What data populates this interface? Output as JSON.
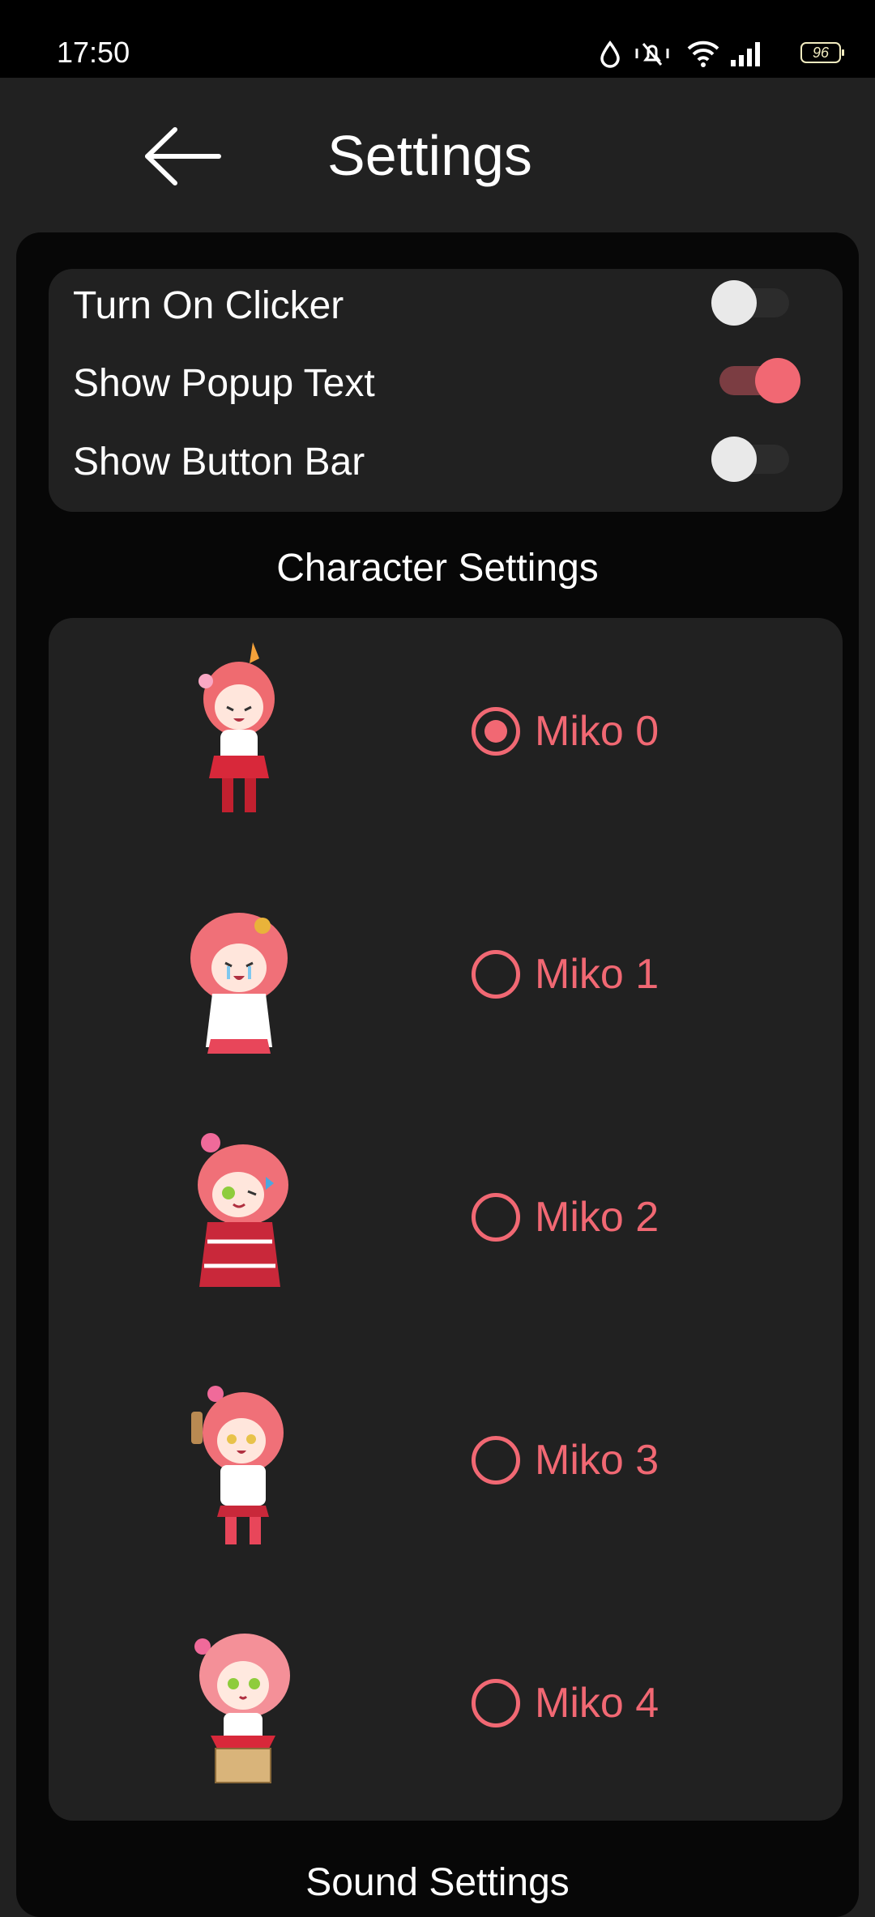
{
  "status_bar": {
    "time": "17:50",
    "battery": "96",
    "icons": [
      "water-drop-icon",
      "vibrate-mute-icon",
      "wifi-icon",
      "signal-icon",
      "battery-icon"
    ]
  },
  "app_bar": {
    "back_icon": "arrow-left-icon",
    "title": "Settings"
  },
  "toggles": [
    {
      "label": "Turn On Clicker",
      "on": false
    },
    {
      "label": "Show Popup Text",
      "on": true
    },
    {
      "label": "Show Button Bar",
      "on": false
    }
  ],
  "character_settings": {
    "title": "Character Settings",
    "selected_index": 0,
    "items": [
      {
        "label": "Miko 0"
      },
      {
        "label": "Miko 1"
      },
      {
        "label": "Miko 2"
      },
      {
        "label": "Miko 3"
      },
      {
        "label": "Miko 4"
      }
    ]
  },
  "sound_settings": {
    "title": "Sound Settings"
  },
  "colors": {
    "accent": "#f16873",
    "background": "#212121",
    "panel": "#070707",
    "status_bar": "#000000"
  }
}
